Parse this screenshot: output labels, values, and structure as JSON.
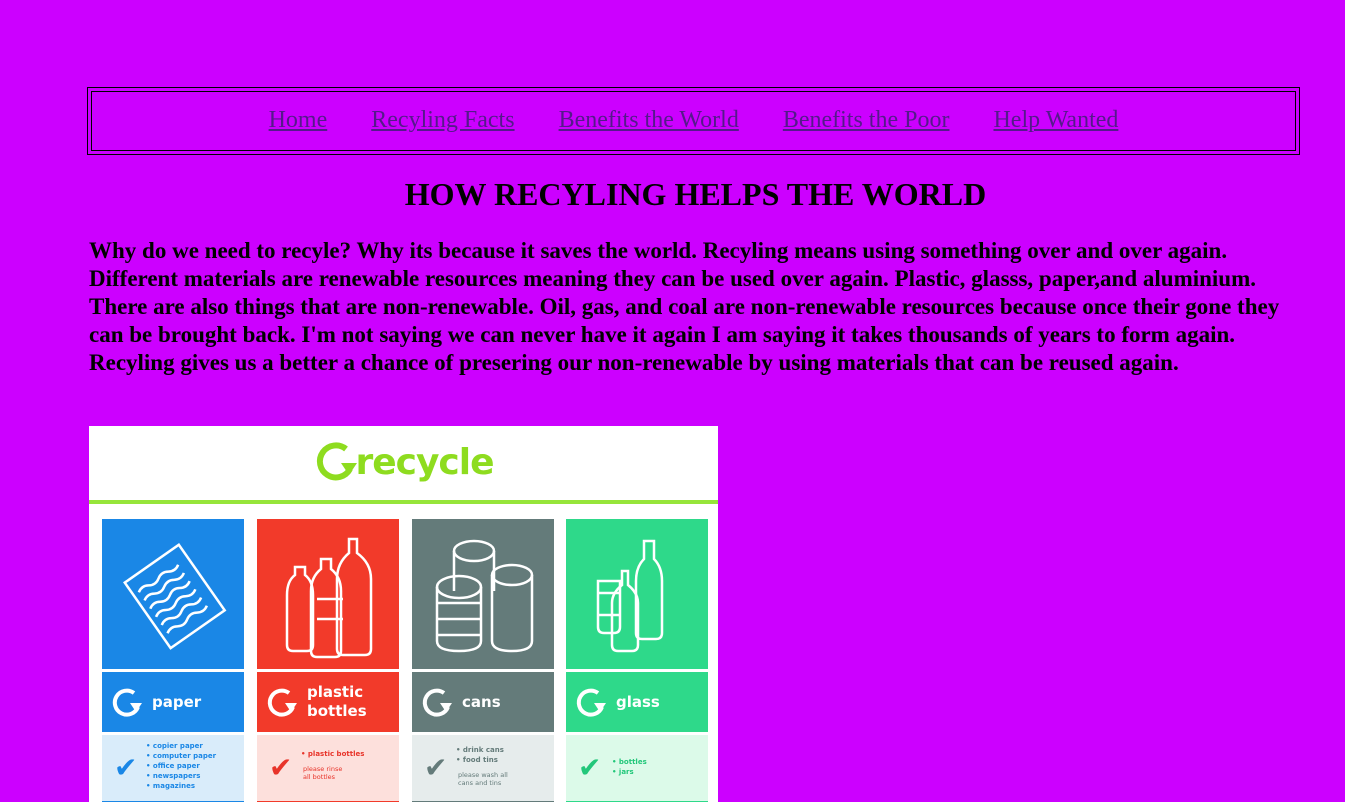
{
  "nav": {
    "items": [
      {
        "label": "Home"
      },
      {
        "label": "Recyling Facts"
      },
      {
        "label": "Benefits the World"
      },
      {
        "label": "Benefits the Poor"
      },
      {
        "label": "Help Wanted"
      }
    ]
  },
  "page": {
    "title": "HOW RECYLING HELPS THE WORLD",
    "paragraph": "Why do we need to recyle? Why its because it saves the world. Recyling means using something over and over again. Different materials are renewable resources meaning they can be used over again. Plastic, glasss, paper,and aluminium. There are also things that are non-renewable. Oil, gas, and coal are non-renewable resources because once their gone they can be brought back. I'm not saying we can never have it again I am saying it takes thousands of years to form again. Recyling gives us a better a chance of presering our non-renewable by using materials that can be reused again."
  },
  "poster": {
    "heading": "recycle",
    "brand_green": "#8edc1f",
    "bins": [
      {
        "label_line1": "paper",
        "label_line2": "",
        "icon": "paper-sheet-icon",
        "color": "#1a87e6",
        "light": "#d9ecfa",
        "text": "#1a87e6",
        "items": [
          "copier paper",
          "computer paper",
          "office paper",
          "newspapers",
          "magazines"
        ],
        "note": ""
      },
      {
        "label_line1": "plastic",
        "label_line2": "bottles",
        "icon": "plastic-bottles-icon",
        "color": "#f23a2a",
        "light": "#fde0dc",
        "text": "#e8342a",
        "items": [
          "plastic bottles"
        ],
        "note": "please rinse all bottles"
      },
      {
        "label_line1": "cans",
        "label_line2": "",
        "icon": "cans-icon",
        "color": "#647b7a",
        "light": "#e6ecec",
        "text": "#647b7a",
        "items": [
          "drink cans",
          "food tins"
        ],
        "note": "please wash all cans and tins"
      },
      {
        "label_line1": "glass",
        "label_line2": "",
        "icon": "glass-bottles-icon",
        "color": "#2ed98a",
        "light": "#dcfae9",
        "text": "#22c77a",
        "items": [
          "bottles",
          "jars"
        ],
        "note": ""
      }
    ]
  }
}
